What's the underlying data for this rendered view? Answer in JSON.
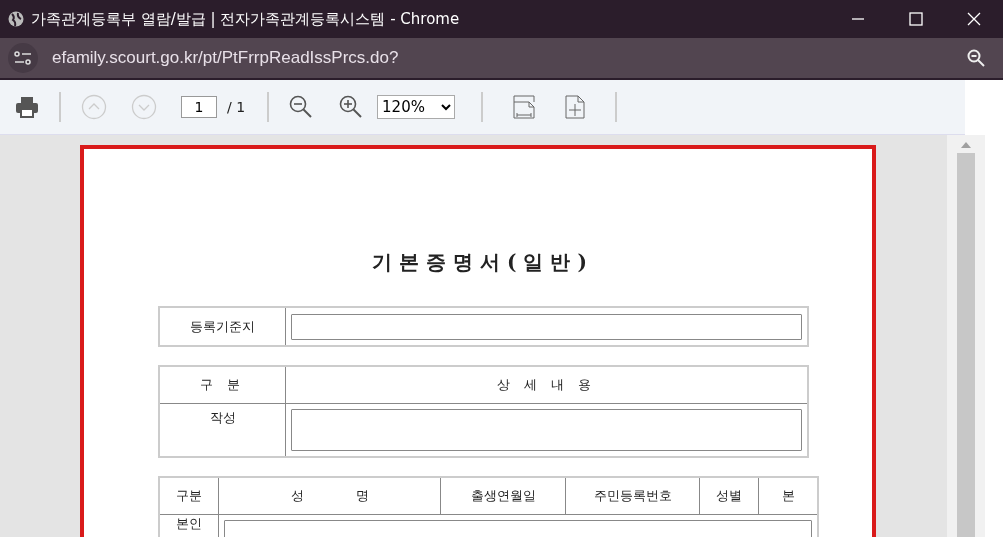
{
  "window": {
    "title": "가족관계등록부 열람/발급 | 전자가족관계등록시스템 - Chrome"
  },
  "address_bar": {
    "url": "efamily.scourt.go.kr/pt/PtFrrpReadIssPrcs.do?"
  },
  "toolbar": {
    "prev_page": {
      "disabled": true
    },
    "next_page": {
      "disabled": true
    },
    "page_number": "1",
    "page_total": "/ 1",
    "zoom": "120%"
  },
  "document": {
    "title": "기본증명서(일반)",
    "registration": {
      "label": "등록기준지"
    },
    "details": {
      "columns": [
        "구 분",
        "상 세 내 용"
      ],
      "rows": [
        {
          "label": "작성"
        }
      ]
    },
    "persons": {
      "columns": [
        "구분",
        "성　　　　명",
        "출생연월일",
        "주민등록번호",
        "성별",
        "본"
      ],
      "rows": [
        {
          "label": "본인"
        }
      ]
    }
  }
}
